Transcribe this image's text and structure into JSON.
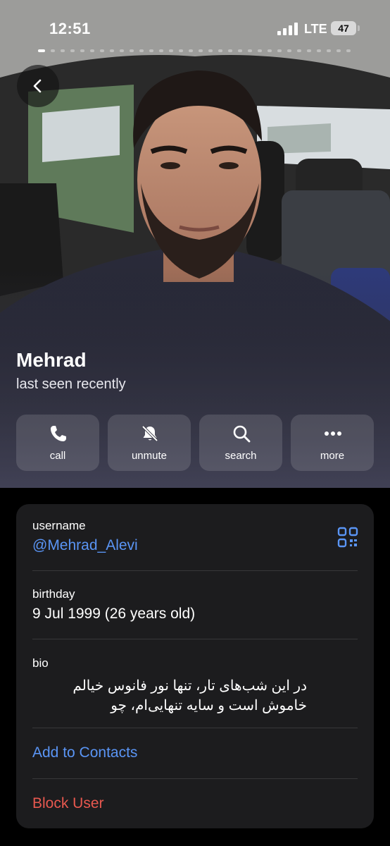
{
  "status_bar": {
    "time": "12:51",
    "network": "LTE",
    "battery": "47"
  },
  "profile": {
    "name": "Mehrad",
    "status": "last seen recently",
    "photo_alt": "profile photo"
  },
  "actions": [
    {
      "label": "call",
      "icon": "phone-icon"
    },
    {
      "label": "unmute",
      "icon": "bell-slash-icon"
    },
    {
      "label": "search",
      "icon": "search-icon"
    },
    {
      "label": "more",
      "icon": "more-dots-icon"
    }
  ],
  "info": {
    "username_label": "username",
    "username_value": "@Mehrad_Alevi",
    "birthday_label": "birthday",
    "birthday_value": "9 Jul 1999 (26 years old)",
    "bio_label": "bio",
    "bio_value": "در این شب‌های تار، تنها نور فانوس خیالم خاموش است و سایه تنهایی‌ام، چو"
  },
  "buttons": {
    "add_contact": "Add to Contacts",
    "block_user": "Block User"
  },
  "colors": {
    "link_blue": "#5a95f5",
    "destructive_red": "#e8584f",
    "card_bg": "#1c1c1e"
  }
}
